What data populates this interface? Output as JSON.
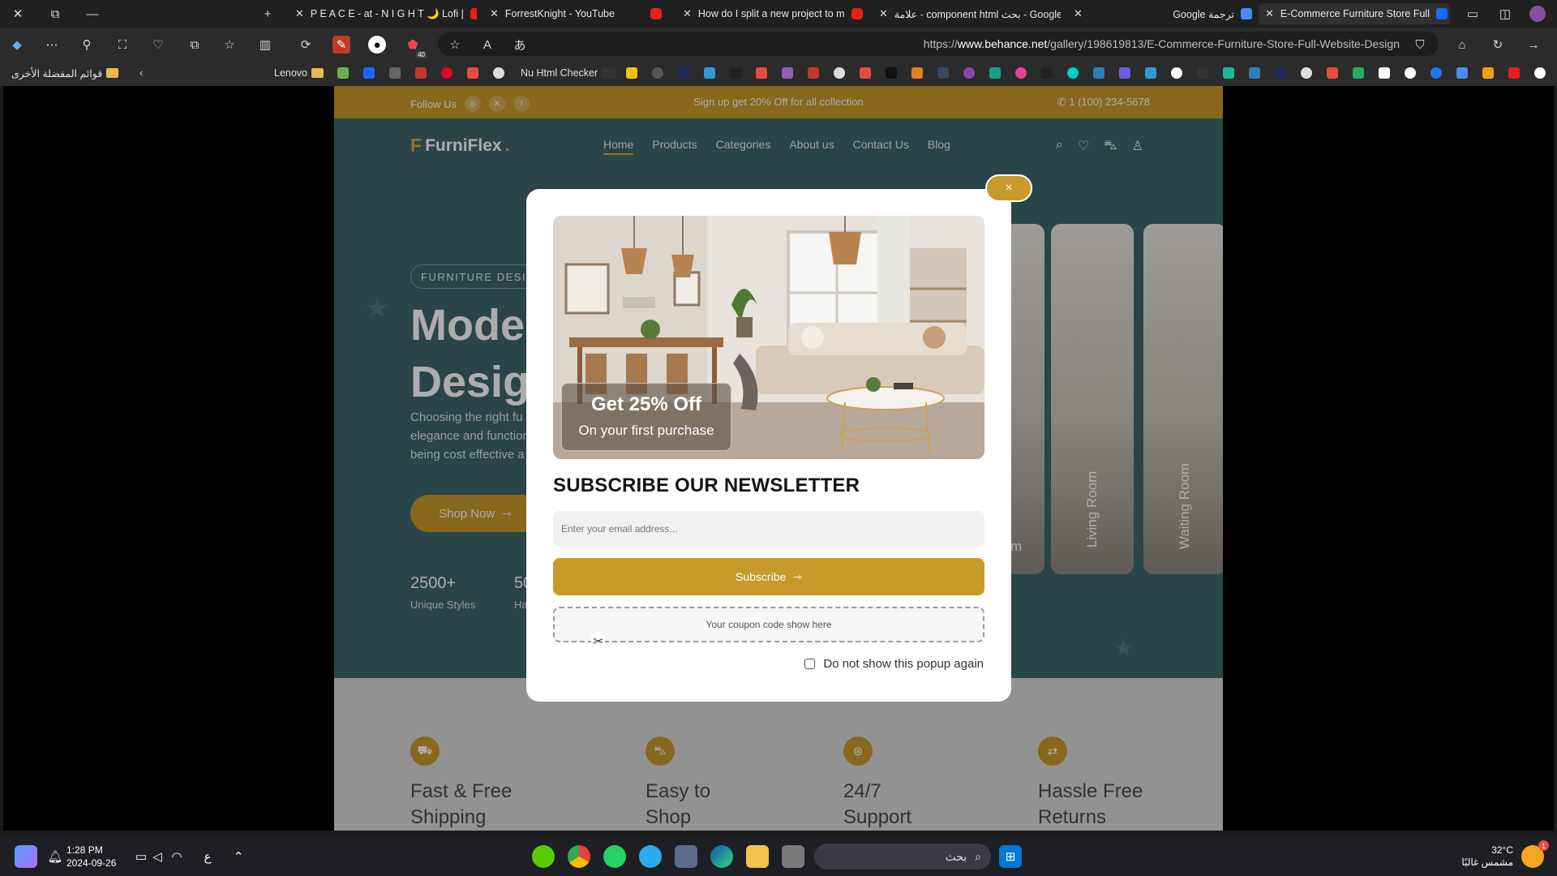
{
  "browser": {
    "tabs": [
      {
        "label": "P E A C E - at - N I G H T 🌙 Lofi |",
        "active": false
      },
      {
        "label": "ForrestKnight - YouTube",
        "active": false
      },
      {
        "label": "How do I split a new project to m",
        "active": false
      },
      {
        "label": "علامة - component html بحث - Google",
        "active": false
      },
      {
        "label": "Google ترجمة",
        "active": false
      },
      {
        "label": "E-Commerce Furniture Store Full",
        "active": true
      }
    ],
    "url_prefix": "https://",
    "url_host": "www.behance.net",
    "url_path": "/gallery/198619813/E-Commerce-Furniture-Store-Full-Website-Design",
    "bookmarks": {
      "other_favorites": "قوائم المفضلة الأخرى",
      "lenovo": "Lenovo",
      "nu_checker": "Nu Html Checker"
    },
    "extension_badge": "40"
  },
  "site": {
    "topbar": {
      "follow": "Follow Us",
      "promo": "Sign up get 20% Off for all collection",
      "phone": "1 (100) 234-5678"
    },
    "brand": "FurniFlex",
    "brand_mark": "F",
    "nav": [
      "Home",
      "Products",
      "Categories",
      "About us",
      "Contact Us",
      "Blog"
    ],
    "hero": {
      "badge": "FURNITURE DESIGN",
      "title_line1": "Moder",
      "title_line2": "Design",
      "paragraph_line1": "Choosing the right fu",
      "paragraph_line2": "elegance and function",
      "paragraph_line3": "being cost effective a",
      "cta": "Shop Now",
      "stat1_value": "2500+",
      "stat1_label": "Unique Styles",
      "stat2_value": "50",
      "stat2_label": "Ha"
    },
    "rooms": [
      {
        "label": "m"
      },
      {
        "label": "Living Room"
      },
      {
        "label": "Waiting Room"
      }
    ],
    "features": [
      {
        "title": "Fast  & Free Shipping",
        "icon": "truck-icon"
      },
      {
        "title": "Easy to Shop",
        "icon": "bag-icon"
      },
      {
        "title": "24/7 Support",
        "icon": "support-icon"
      },
      {
        "title": "Hassle Free Returns",
        "icon": "return-icon"
      }
    ]
  },
  "modal": {
    "offer_title": "Get 25% Off",
    "offer_subtitle": "On your first purchase",
    "heading": "SUBSCRIBE OUR NEWSLETTER",
    "email_placeholder": "Enter your email address...",
    "subscribe_label": "Subscribe",
    "coupon_text": "Your coupon code show here",
    "dont_show_label": "Do not show this popup again",
    "close_label": "×"
  },
  "taskbar": {
    "time": "1:28 PM",
    "date": "2024-09-26",
    "lang": "ع",
    "search_label": "بحث",
    "temperature": "32°C",
    "weather": "مشمس غالبًا",
    "weather_badge": "1"
  },
  "colors": {
    "accent": "#c89a2a",
    "hero_bg": "#3d6669",
    "browser_bg": "#2b2b2b"
  }
}
